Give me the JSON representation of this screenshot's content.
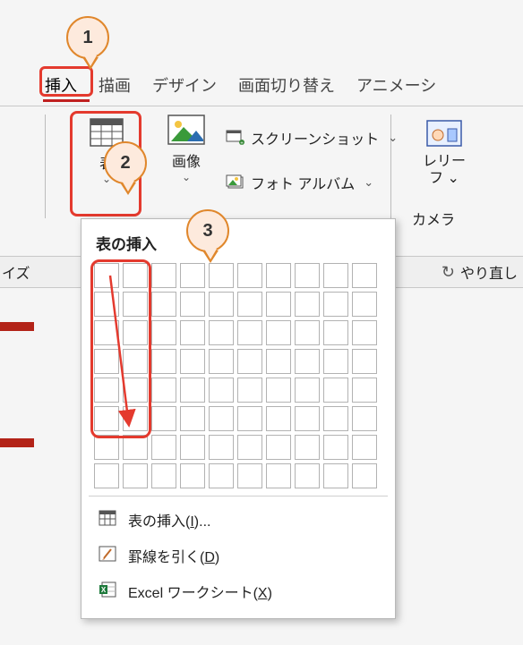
{
  "annotations": {
    "c1": "1",
    "c2": "2",
    "c3": "3"
  },
  "tabs": {
    "insert": "挿入",
    "draw": "描画",
    "design": "デザイン",
    "transition": "画面切り替え",
    "animation": "アニメーシ"
  },
  "ribbon": {
    "table_label": "表",
    "image_label": "画像",
    "screenshot_label": "スクリーンショット",
    "album_label": "フォト アルバム",
    "relief_line1": "レリー",
    "relief_line2": "フ",
    "camera_label": "カメラ"
  },
  "strip": {
    "left_fragment": "イズ",
    "undo_label": "やり直し"
  },
  "dropdown": {
    "title": "表の挿入",
    "grid_cols": 10,
    "grid_rows": 8,
    "menu": {
      "insert_pre": "表の挿入(",
      "insert_u": "I",
      "insert_post": ")...",
      "draw_pre": "罫線を引く(",
      "draw_u": "D",
      "draw_post": ")",
      "excel_pre": "Excel ワークシート(",
      "excel_u": "X",
      "excel_post": ")"
    }
  }
}
